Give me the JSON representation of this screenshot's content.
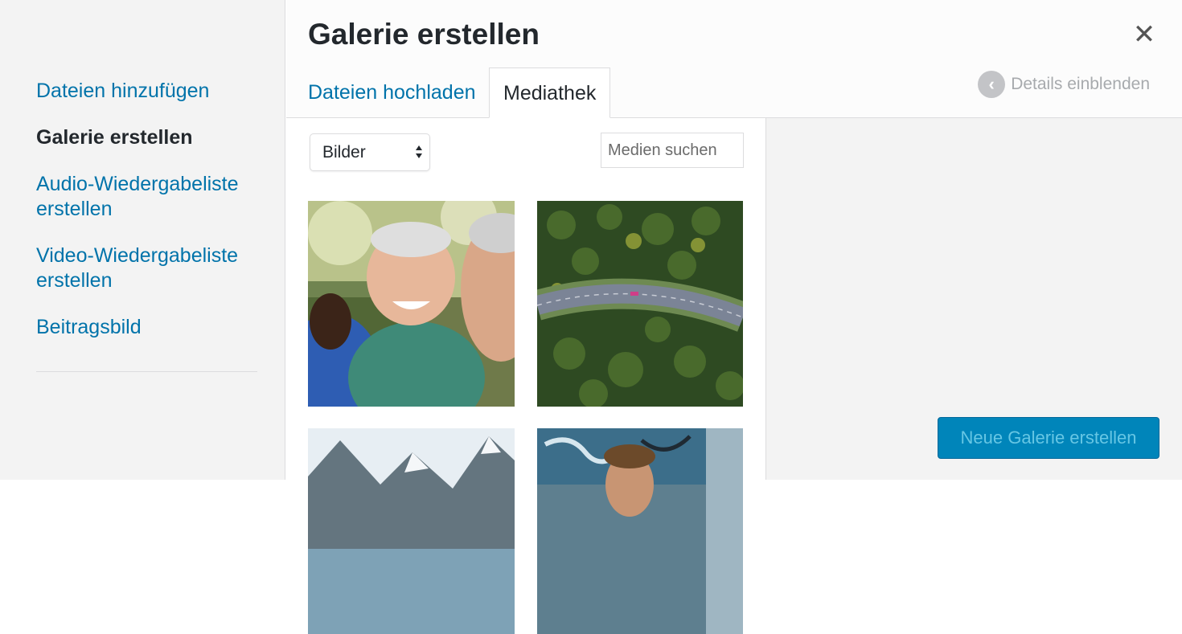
{
  "sidebar": {
    "items": [
      {
        "label": "Dateien hinzufügen",
        "active": false
      },
      {
        "label": "Galerie erstellen",
        "active": true
      },
      {
        "label": "Audio-Wiedergabeliste erstellen",
        "active": false
      },
      {
        "label": "Video-Wiedergabeliste erstellen",
        "active": false
      },
      {
        "label": "Beitragsbild",
        "active": false
      }
    ]
  },
  "header": {
    "title": "Galerie erstellen",
    "close_icon": "close-icon",
    "tabs": [
      {
        "label": "Dateien hochladen",
        "active": false
      },
      {
        "label": "Mediathek",
        "active": true
      }
    ],
    "details_toggle": {
      "label": "Details einblenden",
      "icon": "chevron-left-icon"
    }
  },
  "toolbar": {
    "filter": {
      "selected": "Bilder"
    },
    "search": {
      "placeholder": "Medien suchen",
      "value": ""
    }
  },
  "media": {
    "items": [
      {
        "description": "photo-people-laughing"
      },
      {
        "description": "photo-aerial-road-forest"
      },
      {
        "description": "photo-mountain-lake"
      },
      {
        "description": "photo-graffiti-person"
      }
    ]
  },
  "actions": {
    "primary_label": "Neue Galerie erstellen"
  },
  "colors": {
    "link": "#0073aa",
    "primary": "#0085ba",
    "primary_text_disabled": "#66c6e4"
  }
}
